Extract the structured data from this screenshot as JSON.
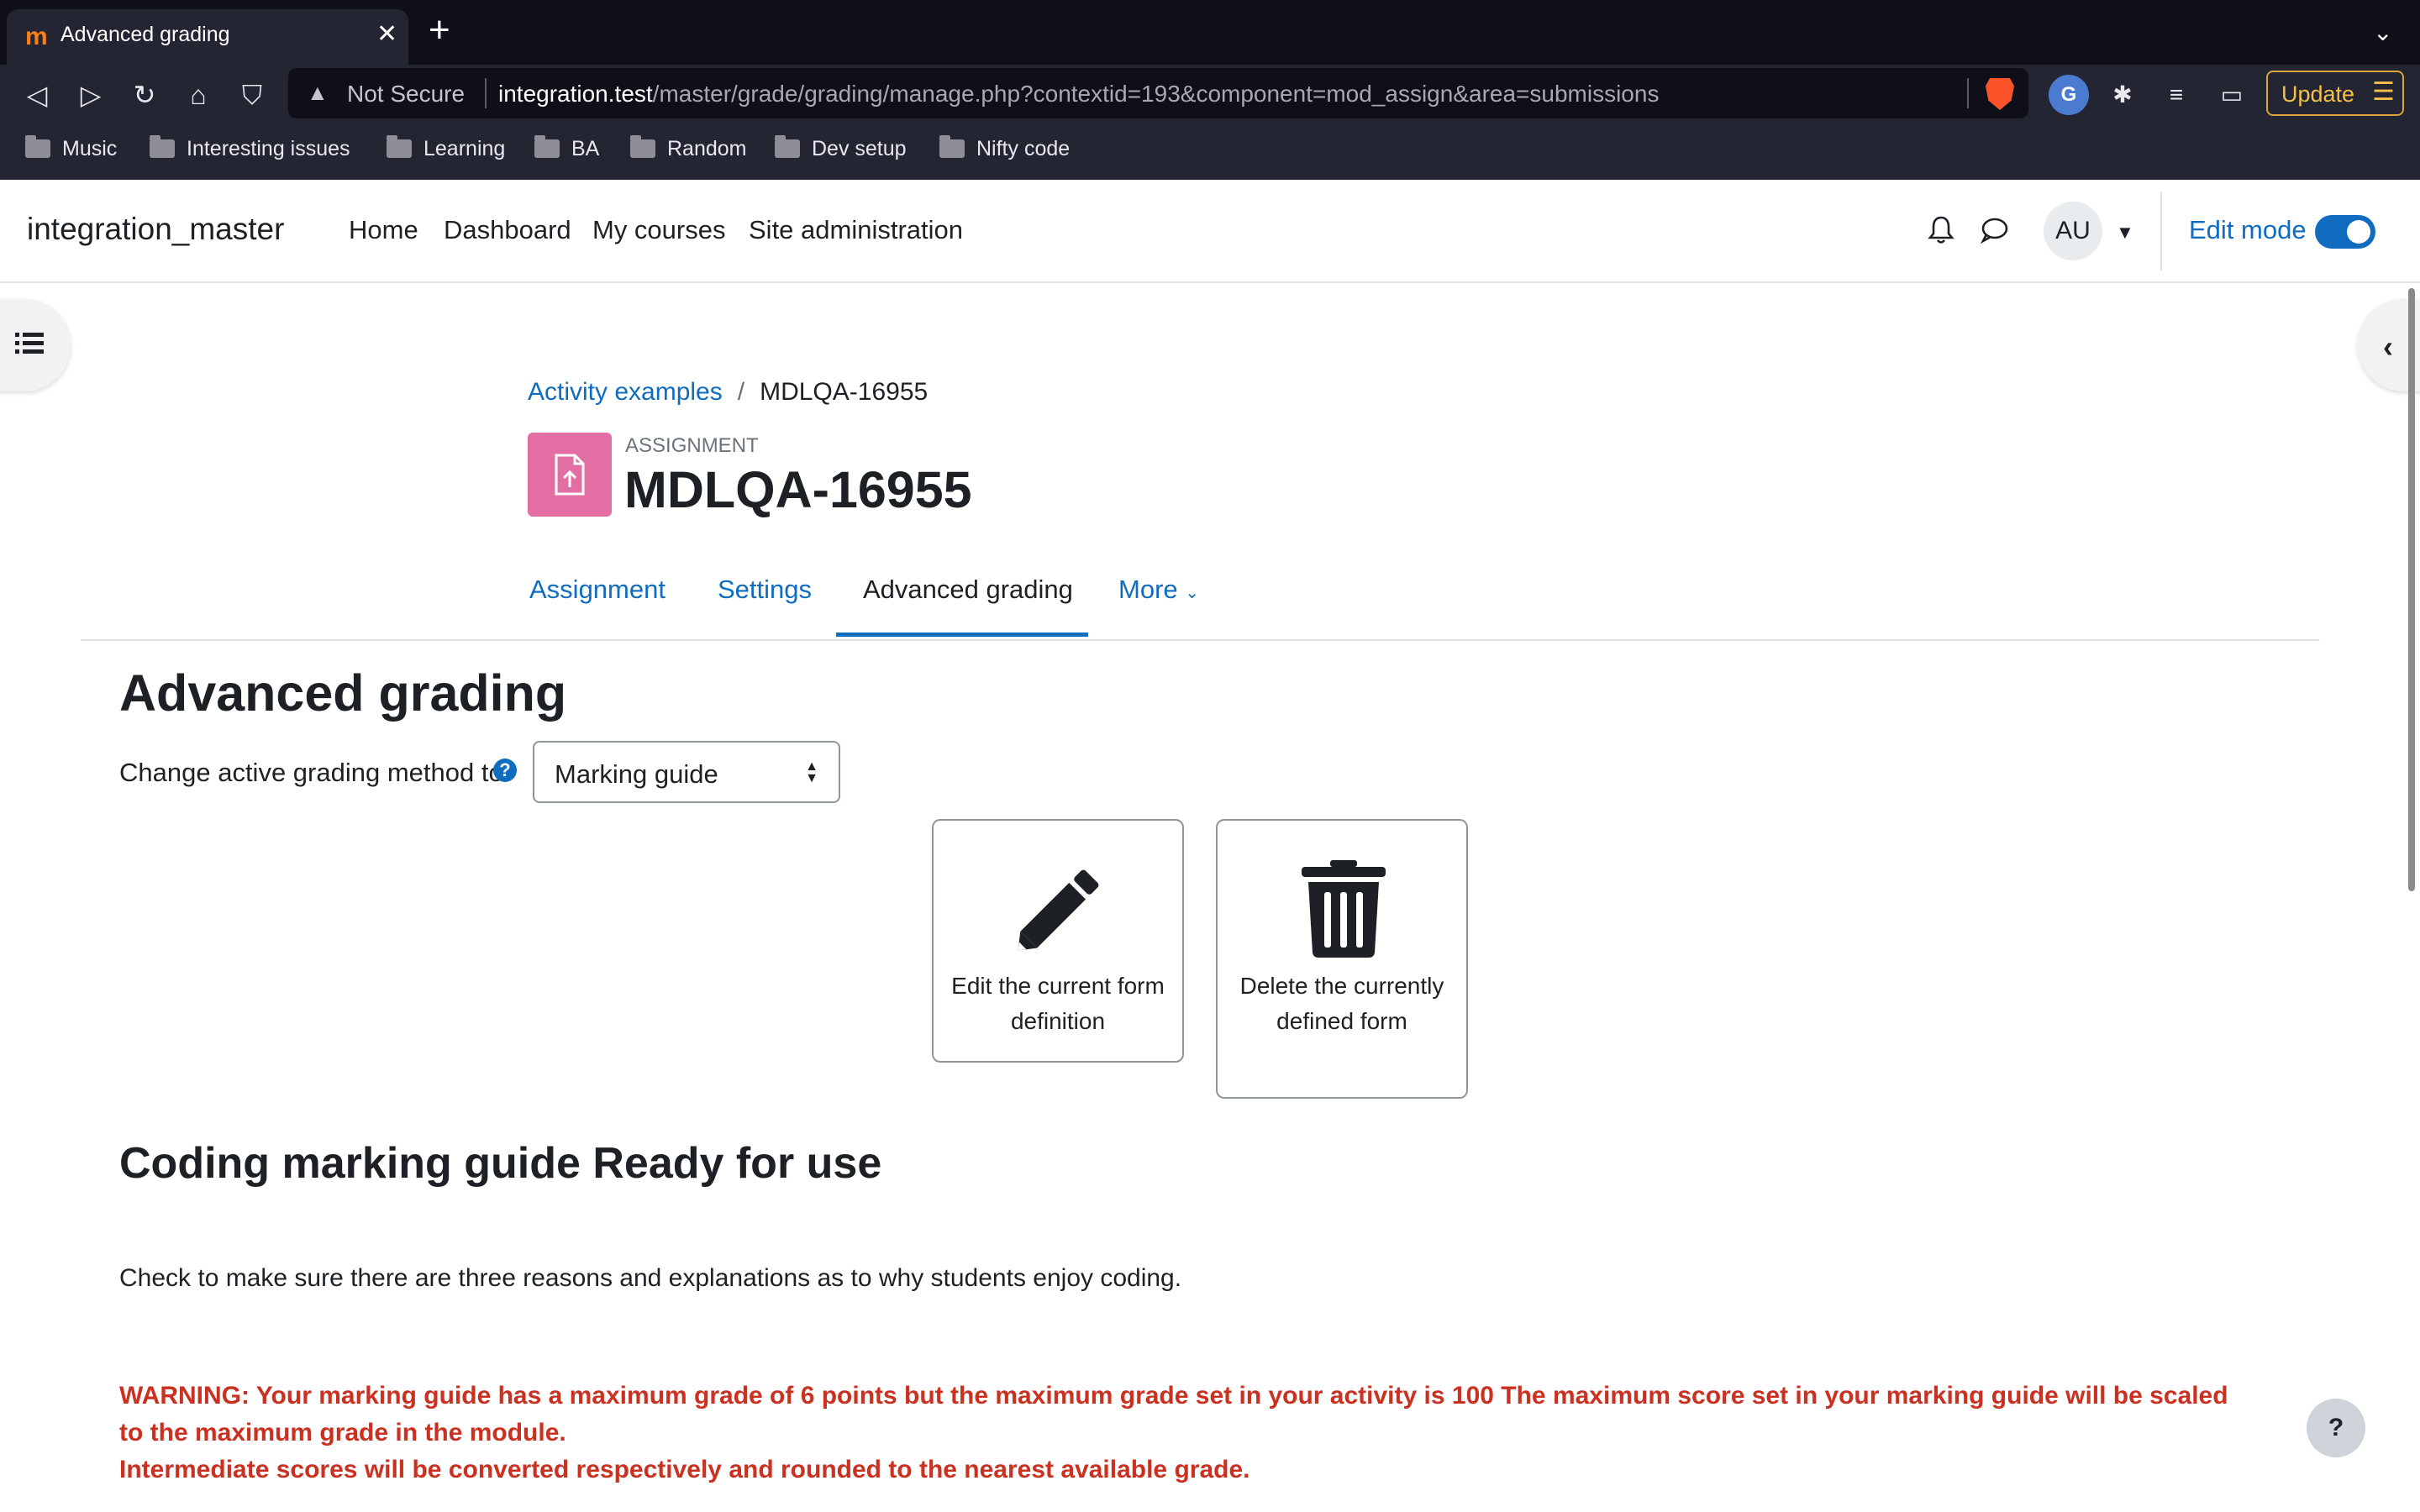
{
  "browser": {
    "tab": {
      "title": "Advanced grading",
      "favicon": "m"
    },
    "new_tab_icon": "+",
    "tab_menu_icon": "⌄",
    "url": {
      "security": "Not Secure",
      "host": "integration.test",
      "path": "/master/grade/grading/manage.php?contextid=193&component=mod_assign&area=submissions"
    },
    "update_label": "Update",
    "bookmarks": [
      "Music",
      "Interesting issues",
      "Learning",
      "BA",
      "Random",
      "Dev setup",
      "Nifty code"
    ]
  },
  "navbar": {
    "site_name": "integration_master",
    "items": [
      "Home",
      "Dashboard",
      "My courses",
      "Site administration"
    ],
    "avatar_initials": "AU",
    "edit_mode_label": "Edit mode",
    "edit_mode_on": true
  },
  "header": {
    "breadcrumb": {
      "parent": "Activity examples",
      "separator": "/",
      "current": "MDLQA-16955"
    },
    "activity_type": "Assignment",
    "activity_title": "MDLQA-16955"
  },
  "secondary_nav": {
    "items": [
      "Assignment",
      "Settings",
      "Advanced grading",
      "More"
    ],
    "active": "Advanced grading"
  },
  "main": {
    "heading": "Advanced grading",
    "method_label": "Change active grading method to",
    "method_value": "Marking guide",
    "actions": {
      "edit_label": "Edit the current form definition",
      "delete_label": "Delete the currently defined form"
    },
    "guide_heading": "Coding marking guide Ready for use",
    "guide_description": "Check to make sure there are three reasons and explanations as to why students enjoy coding.",
    "warning_line1": "WARNING: Your marking guide has a maximum grade of 6 points but the maximum grade set in your activity is 100 The maximum score set in your marking guide will be scaled to the maximum grade in the module.",
    "warning_line2": "Intermediate scores will be converted respectively and rounded to the nearest available grade."
  },
  "help_fab_label": "?",
  "colors": {
    "link": "#0f6cbf",
    "warning": "#ca3120",
    "assignment_icon": "#e26ea4"
  }
}
